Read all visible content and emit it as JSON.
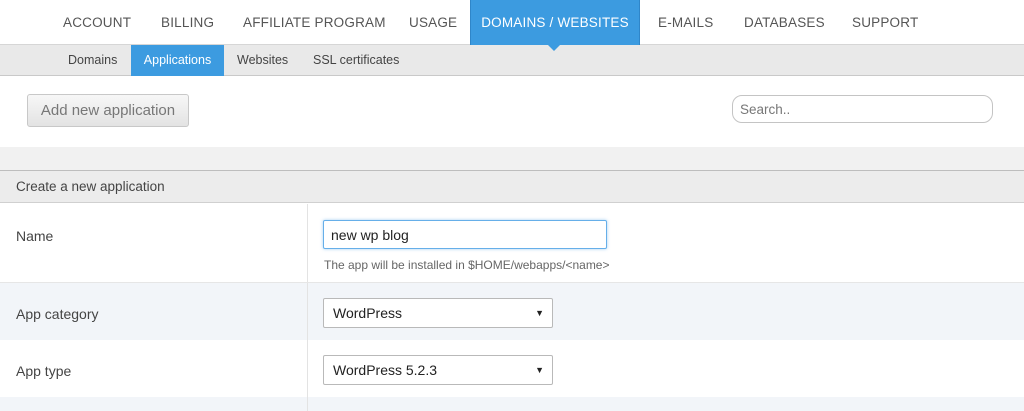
{
  "top_nav": {
    "items": [
      {
        "label": "ACCOUNT",
        "active": false
      },
      {
        "label": "BILLING",
        "active": false
      },
      {
        "label": "AFFILIATE PROGRAM",
        "active": false
      },
      {
        "label": "USAGE",
        "active": false
      },
      {
        "label": "DOMAINS / WEBSITES",
        "active": true
      },
      {
        "label": "E-MAILS",
        "active": false
      },
      {
        "label": "DATABASES",
        "active": false
      },
      {
        "label": "SUPPORT",
        "active": false
      }
    ]
  },
  "sub_nav": {
    "items": [
      {
        "label": "Domains",
        "active": false
      },
      {
        "label": "Applications",
        "active": true
      },
      {
        "label": "Websites",
        "active": false
      },
      {
        "label": "SSL certificates",
        "active": false
      }
    ]
  },
  "toolbar": {
    "add_button_label": "Add new application",
    "search_placeholder": "Search.."
  },
  "form": {
    "title": "Create a new application",
    "name": {
      "label": "Name",
      "value": "new wp blog",
      "hint": "The app will be installed in $HOME/webapps/<name>"
    },
    "category": {
      "label": "App category",
      "selected": "WordPress"
    },
    "type": {
      "label": "App type",
      "selected": "WordPress 5.2.3"
    }
  },
  "colors": {
    "accent": "#3c9be0",
    "focus_border": "#66afe9"
  },
  "icons": {
    "dropdown": "caret-down-icon"
  }
}
